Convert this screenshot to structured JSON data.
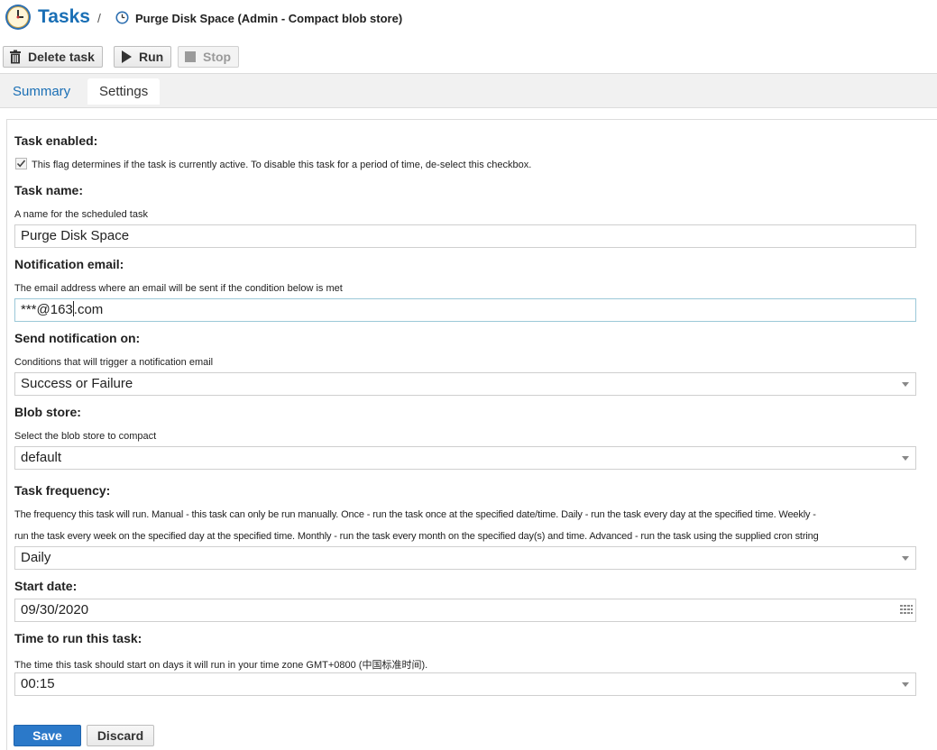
{
  "header": {
    "title": "Tasks",
    "separator": "/",
    "breadcrumb": "Purge Disk Space (Admin - Compact blob store)"
  },
  "toolbar": {
    "delete_label": "Delete task",
    "run_label": "Run",
    "stop_label": "Stop"
  },
  "tabs": [
    {
      "label": "Summary",
      "active": false
    },
    {
      "label": "Settings",
      "active": true
    }
  ],
  "form": {
    "task_enabled": {
      "label": "Task enabled:",
      "checked": true,
      "help": "This flag determines if the task is currently active. To disable this task for a period of time, de-select this checkbox."
    },
    "task_name": {
      "label": "Task name:",
      "help": "A name for the scheduled task",
      "value": "Purge Disk Space"
    },
    "notification_email": {
      "label": "Notification email:",
      "help": "The email address where an email will be sent if the condition below is met",
      "value_before_caret": "***@163",
      "value_after_caret": ".com"
    },
    "send_notification_on": {
      "label": "Send notification on:",
      "help": "Conditions that will trigger a notification email",
      "value": "Success or Failure"
    },
    "blob_store": {
      "label": "Blob store:",
      "help": "Select the blob store to compact",
      "value": "default"
    },
    "task_frequency": {
      "label": "Task frequency:",
      "help_line1": "The frequency this task will run. Manual - this task can only be run manually. Once - run the task once at the specified date/time. Daily - run the task every day at the specified time. Weekly -",
      "help_line2": "run the task every week on the specified day at the specified time. Monthly - run the task every month on the specified day(s) and time. Advanced - run the task using the supplied cron string",
      "value": "Daily"
    },
    "start_date": {
      "label": "Start date:",
      "value": "09/30/2020"
    },
    "time_to_run": {
      "label": "Time to run this task:",
      "help": "The time this task should start on days it will run in your time zone GMT+0800 (中国标准时间).",
      "value": "00:15"
    }
  },
  "buttons": {
    "save_label": "Save",
    "discard_label": "Discard"
  },
  "colors": {
    "accent": "#1a6fb5",
    "primary_button": "#2b79c9",
    "tab_bar_bg": "#f1f1f1"
  },
  "icons": {
    "title": "clock-icon",
    "breadcrumb": "clock-icon",
    "delete": "trash-icon",
    "run": "play-icon",
    "stop": "stop-icon",
    "date": "calendar-icon",
    "dropdown": "chevron-down-icon",
    "enabled": "checkbox-icon"
  }
}
